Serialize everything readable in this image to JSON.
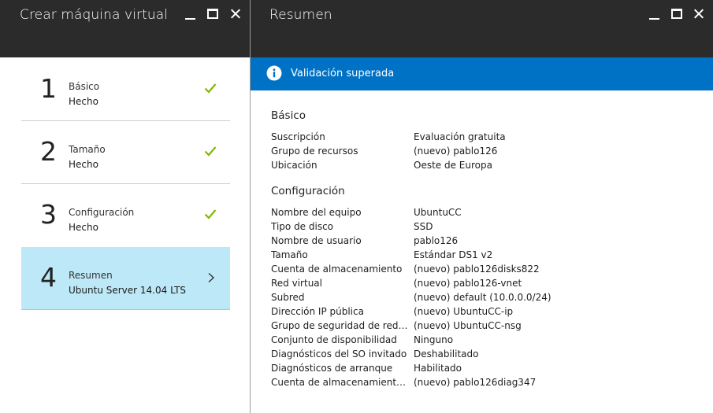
{
  "left_blade": {
    "title": "Crear máquina virtual",
    "steps": [
      {
        "number": "1",
        "title": "Básico",
        "status": "Hecho",
        "state": "done"
      },
      {
        "number": "2",
        "title": "Tamaño",
        "status": "Hecho",
        "state": "done"
      },
      {
        "number": "3",
        "title": "Configuración",
        "status": "Hecho",
        "state": "done"
      },
      {
        "number": "4",
        "title": "Resumen",
        "status": "Ubuntu Server 14.04 LTS",
        "state": "selected"
      }
    ]
  },
  "right_blade": {
    "title": "Resumen",
    "banner": {
      "text": "Validación superada",
      "icon": "info-icon",
      "color": "#0072c6"
    },
    "sections": [
      {
        "title": "Básico",
        "rows": [
          {
            "label": "Suscripción",
            "value": "Evaluación gratuita"
          },
          {
            "label": "Grupo de recursos",
            "value": "(nuevo) pablo126"
          },
          {
            "label": "Ubicación",
            "value": "Oeste de Europa"
          }
        ]
      },
      {
        "title": "Configuración",
        "rows": [
          {
            "label": "Nombre del equipo",
            "value": "UbuntuCC"
          },
          {
            "label": "Tipo de disco",
            "value": "SSD"
          },
          {
            "label": "Nombre de usuario",
            "value": "pablo126"
          },
          {
            "label": "Tamaño",
            "value": "Estándar DS1 v2"
          },
          {
            "label": "Cuenta de almacenamiento",
            "value": "(nuevo) pablo126disks822"
          },
          {
            "label": "Red virtual",
            "value": "(nuevo) pablo126-vnet"
          },
          {
            "label": "Subred",
            "value": "(nuevo) default (10.0.0.0/24)"
          },
          {
            "label": "Dirección IP pública",
            "value": "(nuevo) UbuntuCC-ip"
          },
          {
            "label": "Grupo de seguridad de red (fire...",
            "value": "(nuevo) UbuntuCC-nsg"
          },
          {
            "label": "Conjunto de disponibilidad",
            "value": "Ninguno"
          },
          {
            "label": "Diagnósticos del SO invitado",
            "value": "Deshabilitado"
          },
          {
            "label": "Diagnósticos de arranque",
            "value": "Habilitado"
          },
          {
            "label": "Cuenta de almacenamiento de ...",
            "value": "(nuevo) pablo126diag347"
          }
        ]
      }
    ]
  },
  "colors": {
    "header_bg": "#2b2b2b",
    "check_green": "#7fba00",
    "selected_step_bg": "#bde8f7",
    "banner_bg": "#0072c6"
  },
  "icons": {
    "window_controls": [
      "minimize-icon",
      "maximize-icon",
      "close-icon"
    ],
    "step_done": "check-icon",
    "step_selected": "chevron-right-icon"
  }
}
